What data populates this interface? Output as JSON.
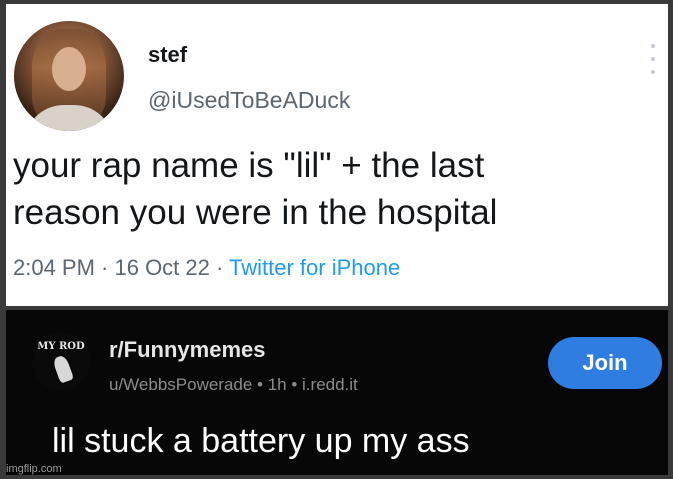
{
  "tweet": {
    "name": "stef",
    "handle": "@iUsedToBeADuck",
    "text_line1": "your rap name is \"lil\" + the last",
    "text_line2": "reason you were in the hospital",
    "timestamp": "2:04 PM · 16 Oct 22 · ",
    "source": "Twitter for iPhone",
    "avatar_icon": "profile-photo",
    "more_icon": "vertical-ellipsis"
  },
  "reddit": {
    "subreddit": "r/Funnymemes",
    "meta": "u/WebbsPowerade • 1h • i.redd.it",
    "join_label": "Join",
    "join_color": "#2f7de1",
    "icon_top_text": "MY ROD",
    "caption": "lil stuck a battery up my ass"
  },
  "watermark": "imgflip.com"
}
